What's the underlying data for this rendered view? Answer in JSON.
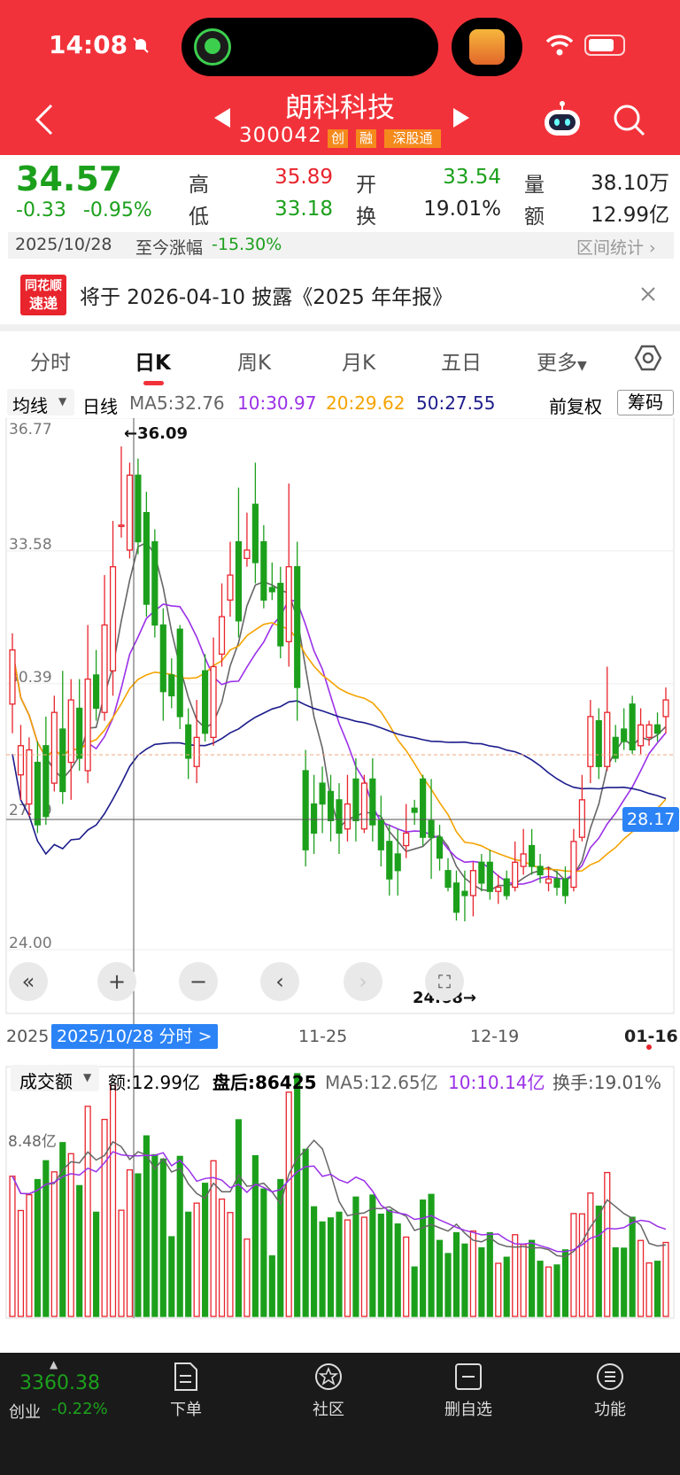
{
  "status": {
    "time": "14:08"
  },
  "header": {
    "title": "朗科科技",
    "code": "300042",
    "tags": [
      "创",
      "融",
      "深股通"
    ]
  },
  "quote": {
    "price": "34.57",
    "change": "-0.33",
    "change_pct": "-0.95%",
    "high_label": "高",
    "high": "35.89",
    "low_label": "低",
    "low": "33.18",
    "open_label": "开",
    "open": "33.54",
    "turnover_label": "换",
    "turnover": "19.01%",
    "volume_label": "量",
    "volume": "38.10万",
    "amount_label": "额",
    "amount": "12.99亿",
    "date": "2025/10/28",
    "since_label": "至今涨幅",
    "since_pct": "-15.30%",
    "range_stats": "区间统计"
  },
  "notice": {
    "logo_line1": "同花顺",
    "logo_line2": "速递",
    "text": "将于 2026-04-10 披露《2025 年年报》"
  },
  "tabs": [
    "分时",
    "日K",
    "周K",
    "月K",
    "五日",
    "更多"
  ],
  "active_tab": "日K",
  "ma_row": {
    "selector": "均线",
    "period": "日线",
    "ma5": "MA5:32.76",
    "ma10": "10:30.97",
    "ma20": "20:29.62",
    "ma50": "50:27.55",
    "adjust": "前复权",
    "chips": "筹码"
  },
  "colors": {
    "up": "#e8242c",
    "down": "#1ca01c",
    "ma5": "#666666",
    "ma10": "#9b30e8",
    "ma20": "#f5a300",
    "ma50": "#1c1c8c",
    "accent": "#2b83f6"
  },
  "chart": {
    "y_ticks": [
      "36.77",
      "33.58",
      "30.39",
      "27.19",
      "24.00"
    ],
    "max_marker": "←36.09",
    "min_marker": "24.68→",
    "current_price": "28.17",
    "x_ticks": [
      "2025",
      "11-25",
      "12-19",
      "01-16"
    ],
    "selected_date": "2025/10/28 分时 >"
  },
  "chart_data": {
    "type": "candlestick",
    "ylim": [
      24.0,
      36.77
    ],
    "y_ticks": [
      36.77,
      33.58,
      30.39,
      27.19,
      24.0
    ],
    "candles": [
      [
        29.9,
        31.2,
        29.2,
        31.6
      ],
      [
        28.2,
        28.9,
        27.6,
        29.4
      ],
      [
        27.5,
        28.8,
        27.2,
        29.1
      ],
      [
        28.5,
        27.0,
        26.8,
        29.0
      ],
      [
        28.9,
        27.2,
        27.0,
        29.6
      ],
      [
        28.0,
        29.7,
        27.8,
        30.1
      ],
      [
        29.3,
        27.8,
        27.5,
        30.7
      ],
      [
        28.5,
        30.0,
        27.6,
        30.5
      ],
      [
        29.8,
        28.6,
        28.3,
        30.5
      ],
      [
        28.3,
        30.5,
        28.0,
        31.8
      ],
      [
        30.6,
        29.8,
        29.5,
        31.2
      ],
      [
        29.7,
        31.8,
        29.5,
        33.0
      ],
      [
        30.7,
        33.2,
        30.1,
        34.3
      ],
      [
        34.2,
        34.2,
        33.9,
        36.09
      ],
      [
        33.6,
        35.4,
        33.4,
        35.7
      ],
      [
        35.4,
        33.8,
        33.5,
        35.8
      ],
      [
        34.5,
        32.3,
        32.0,
        35.0
      ],
      [
        33.8,
        31.8,
        31.5,
        34.1
      ],
      [
        31.8,
        30.2,
        29.5,
        32.2
      ],
      [
        30.6,
        30.1,
        29.8,
        31.0
      ],
      [
        31.7,
        29.6,
        29.3,
        31.8
      ],
      [
        29.4,
        28.6,
        28.1,
        29.8
      ],
      [
        28.4,
        29.1,
        28.0,
        30.0
      ],
      [
        30.7,
        29.2,
        29.0,
        31.1
      ],
      [
        29.1,
        30.8,
        28.9,
        31.5
      ],
      [
        31.1,
        32.0,
        30.8,
        32.8
      ],
      [
        32.4,
        33.0,
        32.0,
        33.8
      ],
      [
        33.8,
        31.9,
        31.5,
        35.1
      ],
      [
        33.4,
        33.6,
        33.2,
        34.5
      ],
      [
        34.7,
        33.3,
        32.8,
        35.7
      ],
      [
        33.8,
        32.4,
        32.2,
        34.2
      ],
      [
        32.7,
        32.6,
        32.4,
        33.3
      ],
      [
        32.8,
        31.3,
        31.0,
        33.2
      ],
      [
        31.4,
        33.2,
        30.8,
        35.2
      ],
      [
        33.2,
        30.3,
        29.5,
        33.8
      ],
      [
        28.3,
        26.4,
        26.0,
        28.8
      ],
      [
        27.5,
        26.8,
        26.3,
        28.2
      ],
      [
        28.0,
        27.5,
        26.8,
        28.4
      ],
      [
        27.8,
        27.1,
        26.6,
        28.2
      ],
      [
        27.6,
        26.8,
        26.3,
        28.0
      ],
      [
        26.9,
        27.5,
        26.6,
        28.2
      ],
      [
        28.1,
        27.1,
        26.6,
        28.6
      ],
      [
        26.9,
        28.0,
        26.8,
        28.2
      ],
      [
        28.1,
        27.0,
        26.6,
        28.6
      ],
      [
        27.1,
        26.4,
        26.0,
        27.7
      ],
      [
        26.6,
        25.7,
        25.3,
        27.0
      ],
      [
        26.3,
        25.9,
        25.3,
        26.9
      ],
      [
        26.5,
        26.8,
        26.2,
        27.5
      ],
      [
        27.4,
        27.3,
        27.0,
        27.6
      ],
      [
        28.1,
        26.7,
        26.5,
        28.2
      ],
      [
        27.1,
        26.7,
        25.7,
        28.1
      ],
      [
        26.7,
        26.2,
        25.9,
        27.0
      ],
      [
        25.9,
        25.5,
        25.4,
        26.2
      ],
      [
        25.6,
        24.9,
        24.7,
        25.9
      ],
      [
        25.4,
        25.3,
        24.68,
        25.9
      ],
      [
        25.3,
        25.9,
        24.8,
        26.1
      ],
      [
        26.1,
        25.6,
        25.4,
        26.3
      ],
      [
        26.1,
        25.4,
        25.2,
        26.4
      ],
      [
        25.4,
        25.5,
        25.1,
        25.8
      ],
      [
        25.7,
        25.3,
        25.2,
        25.9
      ],
      [
        25.5,
        26.1,
        25.4,
        26.6
      ],
      [
        26.0,
        26.3,
        25.8,
        26.9
      ],
      [
        26.5,
        26.0,
        25.8,
        26.9
      ],
      [
        26.0,
        25.8,
        25.6,
        26.3
      ],
      [
        25.6,
        25.7,
        25.4,
        26.0
      ],
      [
        25.7,
        25.5,
        25.3,
        25.9
      ],
      [
        25.7,
        25.3,
        25.1,
        26.0
      ],
      [
        25.5,
        26.6,
        25.4,
        26.9
      ],
      [
        26.7,
        27.6,
        26.6,
        28.2
      ],
      [
        28.4,
        29.6,
        28.0,
        30.0
      ],
      [
        29.5,
        28.4,
        28.1,
        29.8
      ],
      [
        28.4,
        29.7,
        28.3,
        30.8
      ],
      [
        29.1,
        28.6,
        28.5,
        29.4
      ],
      [
        29.3,
        29.0,
        28.8,
        29.8
      ],
      [
        29.9,
        28.8,
        28.7,
        30.1
      ],
      [
        28.9,
        29.4,
        28.7,
        29.8
      ],
      [
        29.1,
        29.4,
        28.9,
        29.5
      ],
      [
        29.4,
        29.2,
        29.0,
        29.7
      ],
      [
        29.6,
        30.0,
        29.2,
        30.3
      ]
    ],
    "volume_ylabel": "8.48亿",
    "volume_amount": "额:12.99亿",
    "after_hours": "盘后:86425",
    "volume_ma5": "MA5:12.65亿",
    "volume_ma10": "10:10.14亿",
    "turnover": "换手:19.01%"
  },
  "volume_panel": {
    "selector": "成交额"
  },
  "bottom_bar": {
    "index_value": "3360.38",
    "index_name": "创业",
    "index_change": "-0.22%",
    "items": [
      "下单",
      "社区",
      "删自选",
      "功能"
    ]
  }
}
